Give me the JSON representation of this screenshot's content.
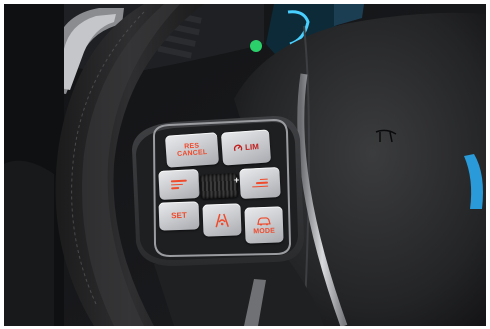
{
  "photo": {
    "subject": "steering-wheel-cruise-control-buttons",
    "accent_color": "#f0492b",
    "limiter_color": "#c21e1e"
  },
  "buttons": {
    "res_cancel": {
      "line1": "RES",
      "line2": "CANCEL"
    },
    "lim": {
      "label": "LIM",
      "icon": "speed-limiter-icon"
    },
    "set": {
      "label": "SET"
    },
    "mode": {
      "label": "MODE",
      "icon": "car-mode-icon"
    },
    "assist": {
      "icon": "lane-assist-icon"
    },
    "roller": {
      "plus": "+",
      "icon": "thumbwheel-icon"
    }
  }
}
